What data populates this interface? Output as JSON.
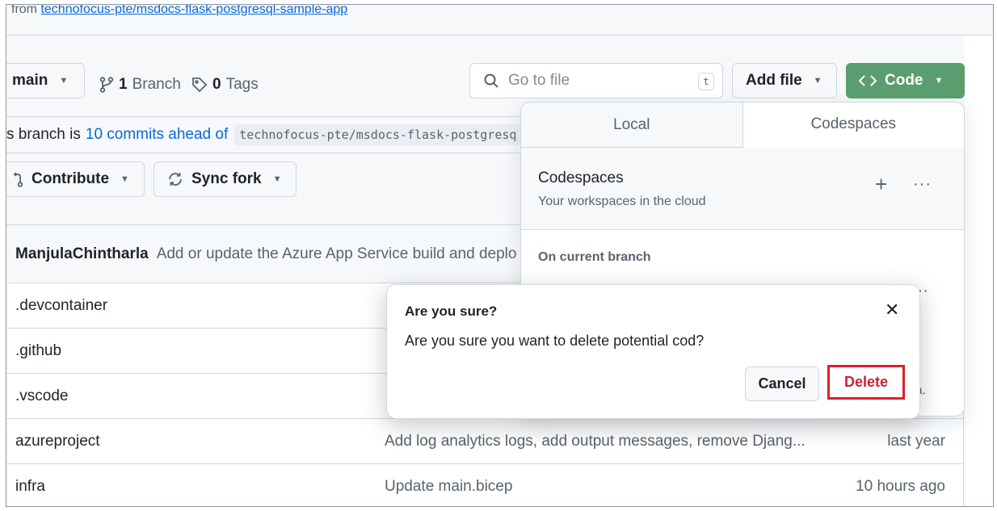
{
  "repo": {
    "forked_from_prefix": "from",
    "forked_from_link": "technofocus-pte/msdocs-flask-postgresql-sample-app"
  },
  "toolbar": {
    "branch_name": "main",
    "branch_count": "1",
    "branch_label": "Branch",
    "tag_count": "0",
    "tag_label": "Tags",
    "search_placeholder": "Go to file",
    "search_shortcut": "t",
    "add_file_label": "Add file",
    "code_label": "Code"
  },
  "branch_status": {
    "prefix": "s branch is",
    "ahead_link": "10 commits ahead of",
    "upstream": "technofocus-pte/msdocs-flask-postgresq"
  },
  "actions": {
    "contribute_label": "Contribute",
    "sync_fork_label": "Sync fork"
  },
  "latest_commit": {
    "author": "ManjulaChintharla",
    "message": "Add or update the Azure App Service build and deplo"
  },
  "files": [
    {
      "name": ".devcontainer",
      "message": "",
      "date": ""
    },
    {
      "name": ".github",
      "message": "",
      "date": ""
    },
    {
      "name": ".vscode",
      "message": "",
      "date": ""
    },
    {
      "name": "azureproject",
      "message": "Add log analytics logs, add output messages, remove Djang...",
      "date": "last year"
    },
    {
      "name": "infra",
      "message": "Update main.bicep",
      "date": "10 hours ago"
    }
  ],
  "code_popover": {
    "tab_local": "Local",
    "tab_codespaces": "Codespaces",
    "codespaces_title": "Codespaces",
    "codespaces_subtitle": "Your workspaces in the cloud",
    "plus": "+",
    "more": "···",
    "section_label": "On current branch",
    "row_more": "···",
    "author_fragment": "arla."
  },
  "dialog": {
    "title": "Are you sure?",
    "message": "Are you sure you want to delete potential cod?",
    "cancel_label": "Cancel",
    "delete_label": "Delete",
    "close_glyph": "✕"
  },
  "colors": {
    "code_button_bg": "#5a9e6f",
    "delete_text": "#cf222e",
    "delete_highlight_border": "#e01f26",
    "link": "#0969da"
  }
}
